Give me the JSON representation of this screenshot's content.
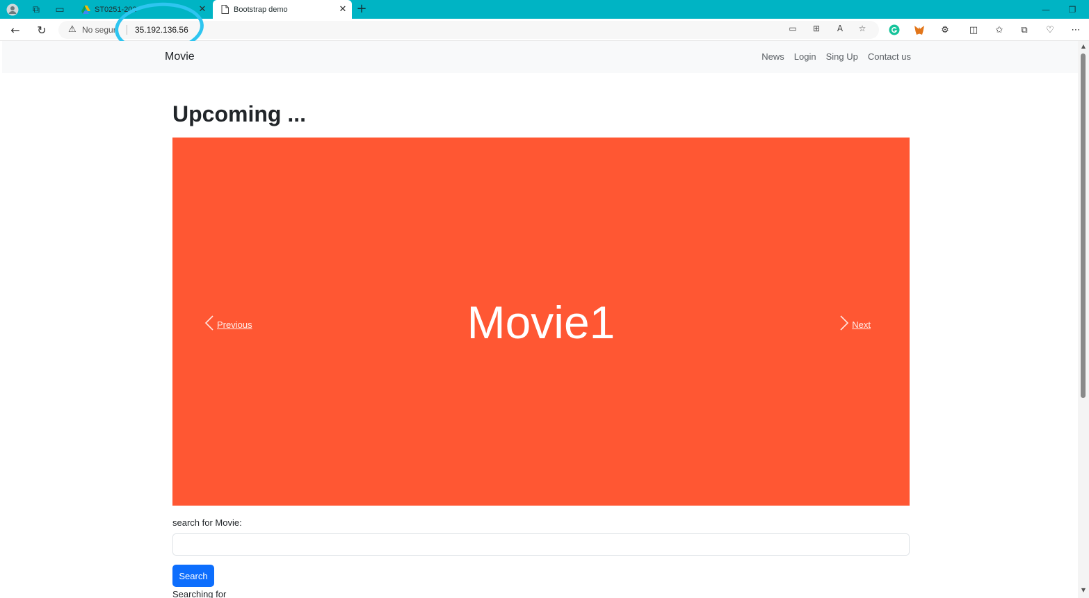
{
  "browser": {
    "tabs": [
      {
        "title": "ST0251-202",
        "active": false,
        "favicon": "drive-icon"
      },
      {
        "title": "Bootstrap demo",
        "active": true,
        "favicon": "page-icon"
      }
    ],
    "security_label": "No seguro",
    "url": "35.192.136.56",
    "theme_color": "#00b4c4"
  },
  "navbar": {
    "brand": "Movie",
    "links": [
      "News",
      "Login",
      "Sing Up",
      "Contact us"
    ]
  },
  "main": {
    "heading": "Upcoming ...",
    "carousel": {
      "slide_text": "Movie1",
      "slide_color": "#ff5733",
      "prev_label": "Previous",
      "next_label": "Next"
    },
    "search": {
      "label": "search for Movie:",
      "value": "",
      "button_label": "Search",
      "button_color": "#0d6efd",
      "result_text": "Searching for"
    }
  }
}
